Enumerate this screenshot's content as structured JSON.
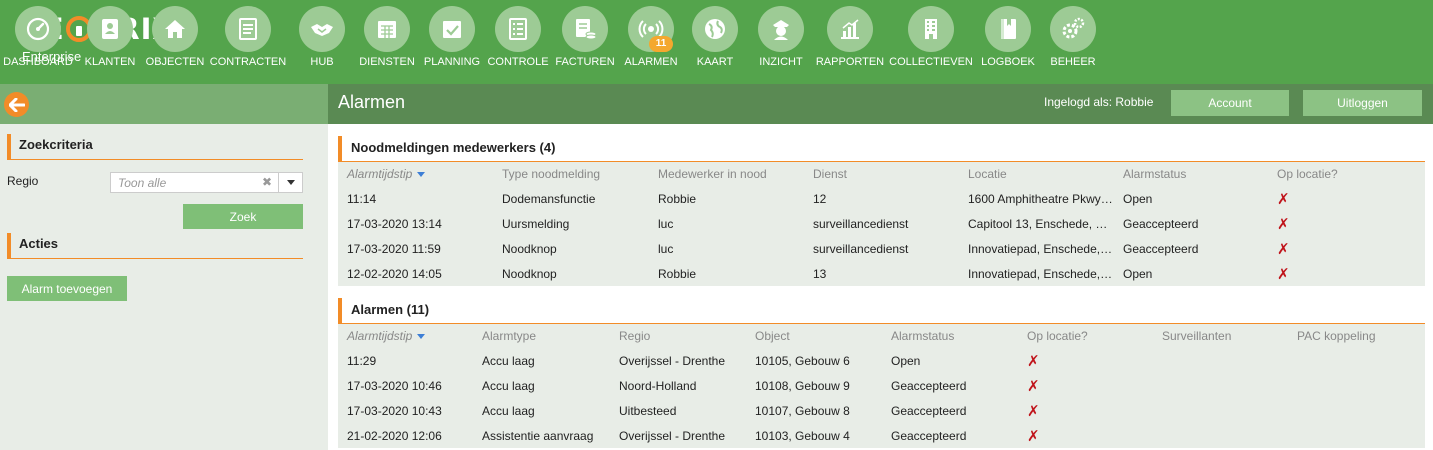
{
  "brand": {
    "name": "SEQURIX",
    "name_left": "SE",
    "name_right": "URIX",
    "subtitle": "Enterprise",
    "accent": "#f28c28",
    "green": "#54a44c"
  },
  "nav": [
    {
      "label": "DASHBOARD",
      "icon": "gauge-icon"
    },
    {
      "label": "KLANTEN",
      "icon": "contacts-icon"
    },
    {
      "label": "OBJECTEN",
      "icon": "home-icon"
    },
    {
      "label": "CONTRACTEN",
      "icon": "document-icon"
    },
    {
      "label": "HUB",
      "icon": "handshake-icon"
    },
    {
      "label": "DIENSTEN",
      "icon": "calendar-icon"
    },
    {
      "label": "PLANNING",
      "icon": "calendar-check-icon"
    },
    {
      "label": "CONTROLE",
      "icon": "checklist-icon"
    },
    {
      "label": "FACTUREN",
      "icon": "invoice-icon"
    },
    {
      "label": "ALARMEN",
      "icon": "broadcast-icon",
      "badge": "11"
    },
    {
      "label": "KAART",
      "icon": "globe-icon"
    },
    {
      "label": "INZICHT",
      "icon": "officer-icon"
    },
    {
      "label": "RAPPORTEN",
      "icon": "bar-chart-icon"
    },
    {
      "label": "COLLECTIEVEN",
      "icon": "building-icon"
    },
    {
      "label": "LOGBOEK",
      "icon": "book-icon"
    },
    {
      "label": "BEHEER",
      "icon": "gears-icon"
    }
  ],
  "header": {
    "title": "Alarmen",
    "logged_in": "Ingelogd als: Robbie",
    "account_label": "Account",
    "logout_label": "Uitloggen"
  },
  "sidebar": {
    "search_title": "Zoekcriteria",
    "regio_label": "Regio",
    "regio_placeholder": "Toon alle",
    "search_button": "Zoek",
    "actions_title": "Acties",
    "add_alarm_button": "Alarm toevoegen"
  },
  "emergencies": {
    "title": "Noodmeldingen medewerkers (4)",
    "columns": [
      "Alarmtijdstip",
      "Type noodmelding",
      "Medewerker in nood",
      "Dienst",
      "Locatie",
      "Alarmstatus",
      "Op locatie?"
    ],
    "rows": [
      [
        "11:14",
        "Dodemansfunctie",
        "Robbie",
        "12",
        "1600 Amphitheatre Pkwy…",
        "Open",
        "✗"
      ],
      [
        "17-03-2020 13:14",
        "Uursmelding",
        "luc",
        "surveillancedienst",
        "Capitool 13, Enschede, …",
        "Geaccepteerd",
        "✗"
      ],
      [
        "17-03-2020 11:59",
        "Noodknop",
        "luc",
        "surveillancedienst",
        "Innovatiepad, Enschede,…",
        "Geaccepteerd",
        "✗"
      ],
      [
        "12-02-2020 14:05",
        "Noodknop",
        "Robbie",
        "13",
        "Innovatiepad, Enschede,…",
        "Open",
        "✗"
      ]
    ]
  },
  "alarms": {
    "title": "Alarmen (11)",
    "columns": [
      "Alarmtijdstip",
      "Alarmtype",
      "Regio",
      "Object",
      "Alarmstatus",
      "Op locatie?",
      "Surveillanten",
      "PAC koppeling"
    ],
    "rows": [
      [
        "11:29",
        "Accu laag",
        "Overijssel - Drenthe",
        "10105, Gebouw 6",
        "Open",
        "✗",
        "",
        ""
      ],
      [
        "17-03-2020 10:46",
        "Accu laag",
        "Noord-Holland",
        "10108, Gebouw 9",
        "Geaccepteerd",
        "✗",
        "",
        ""
      ],
      [
        "17-03-2020 10:43",
        "Accu laag",
        "Uitbesteed",
        "10107, Gebouw 8",
        "Geaccepteerd",
        "✗",
        "",
        ""
      ],
      [
        "21-02-2020 12:06",
        "Assistentie aanvraag",
        "Overijssel - Drenthe",
        "10103, Gebouw 4",
        "Geaccepteerd",
        "✗",
        "",
        ""
      ]
    ]
  }
}
